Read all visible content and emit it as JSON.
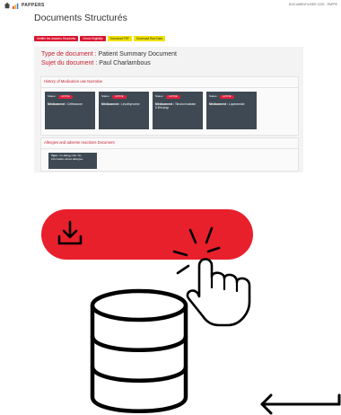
{
  "header": {
    "logo_text": "PAPPERS",
    "user_text": "DOCUMENT/USER 2202 - PAPPE"
  },
  "page_title": "Documents Structurés",
  "toolbar": {
    "buttons": [
      {
        "label": "Vérifier les dossiers Structurés",
        "color": "#d9152f"
      },
      {
        "label": "Check Eligibility",
        "color": "#d9152f"
      },
      {
        "label": "Download PDF",
        "color": "#f2e200"
      },
      {
        "label": "Download Raw Data",
        "color": "#f2e200"
      }
    ]
  },
  "document": {
    "type_label": "Type de document :",
    "type_value": "Patient Summary Document",
    "subject_label": "Sujet du document :",
    "subject_value": "Paul Charlambous"
  },
  "medications_section": {
    "title": "History of Medication use Narrative",
    "cards": [
      {
        "status_label": "Status :",
        "status_badge": "ACTIVE",
        "label": "Médicament :",
        "value": "Ceftriaxone"
      },
      {
        "status_label": "Status :",
        "status_badge": "ACTIVE",
        "label": "Médicament :",
        "value": "Levothyroxine"
      },
      {
        "status_label": "Status :",
        "status_badge": "ACTIVE",
        "label": "Médicament :",
        "value": "Timolol maleate 0.5% drop"
      },
      {
        "status_label": "Status :",
        "status_badge": "ACTIVE",
        "label": "Médicament :",
        "value": "Loperamide"
      }
    ]
  },
  "allergies_section": {
    "title": "Allergies and adverse reactions Document",
    "card": {
      "type_label": "Type :",
      "type_value": "no allergy risk. No information about allergies."
    }
  },
  "illustration": {
    "button_color": "#e8202c",
    "icons": [
      "download-icon",
      "hand-pointer-icon",
      "database-icon",
      "arrow-left-icon"
    ]
  }
}
